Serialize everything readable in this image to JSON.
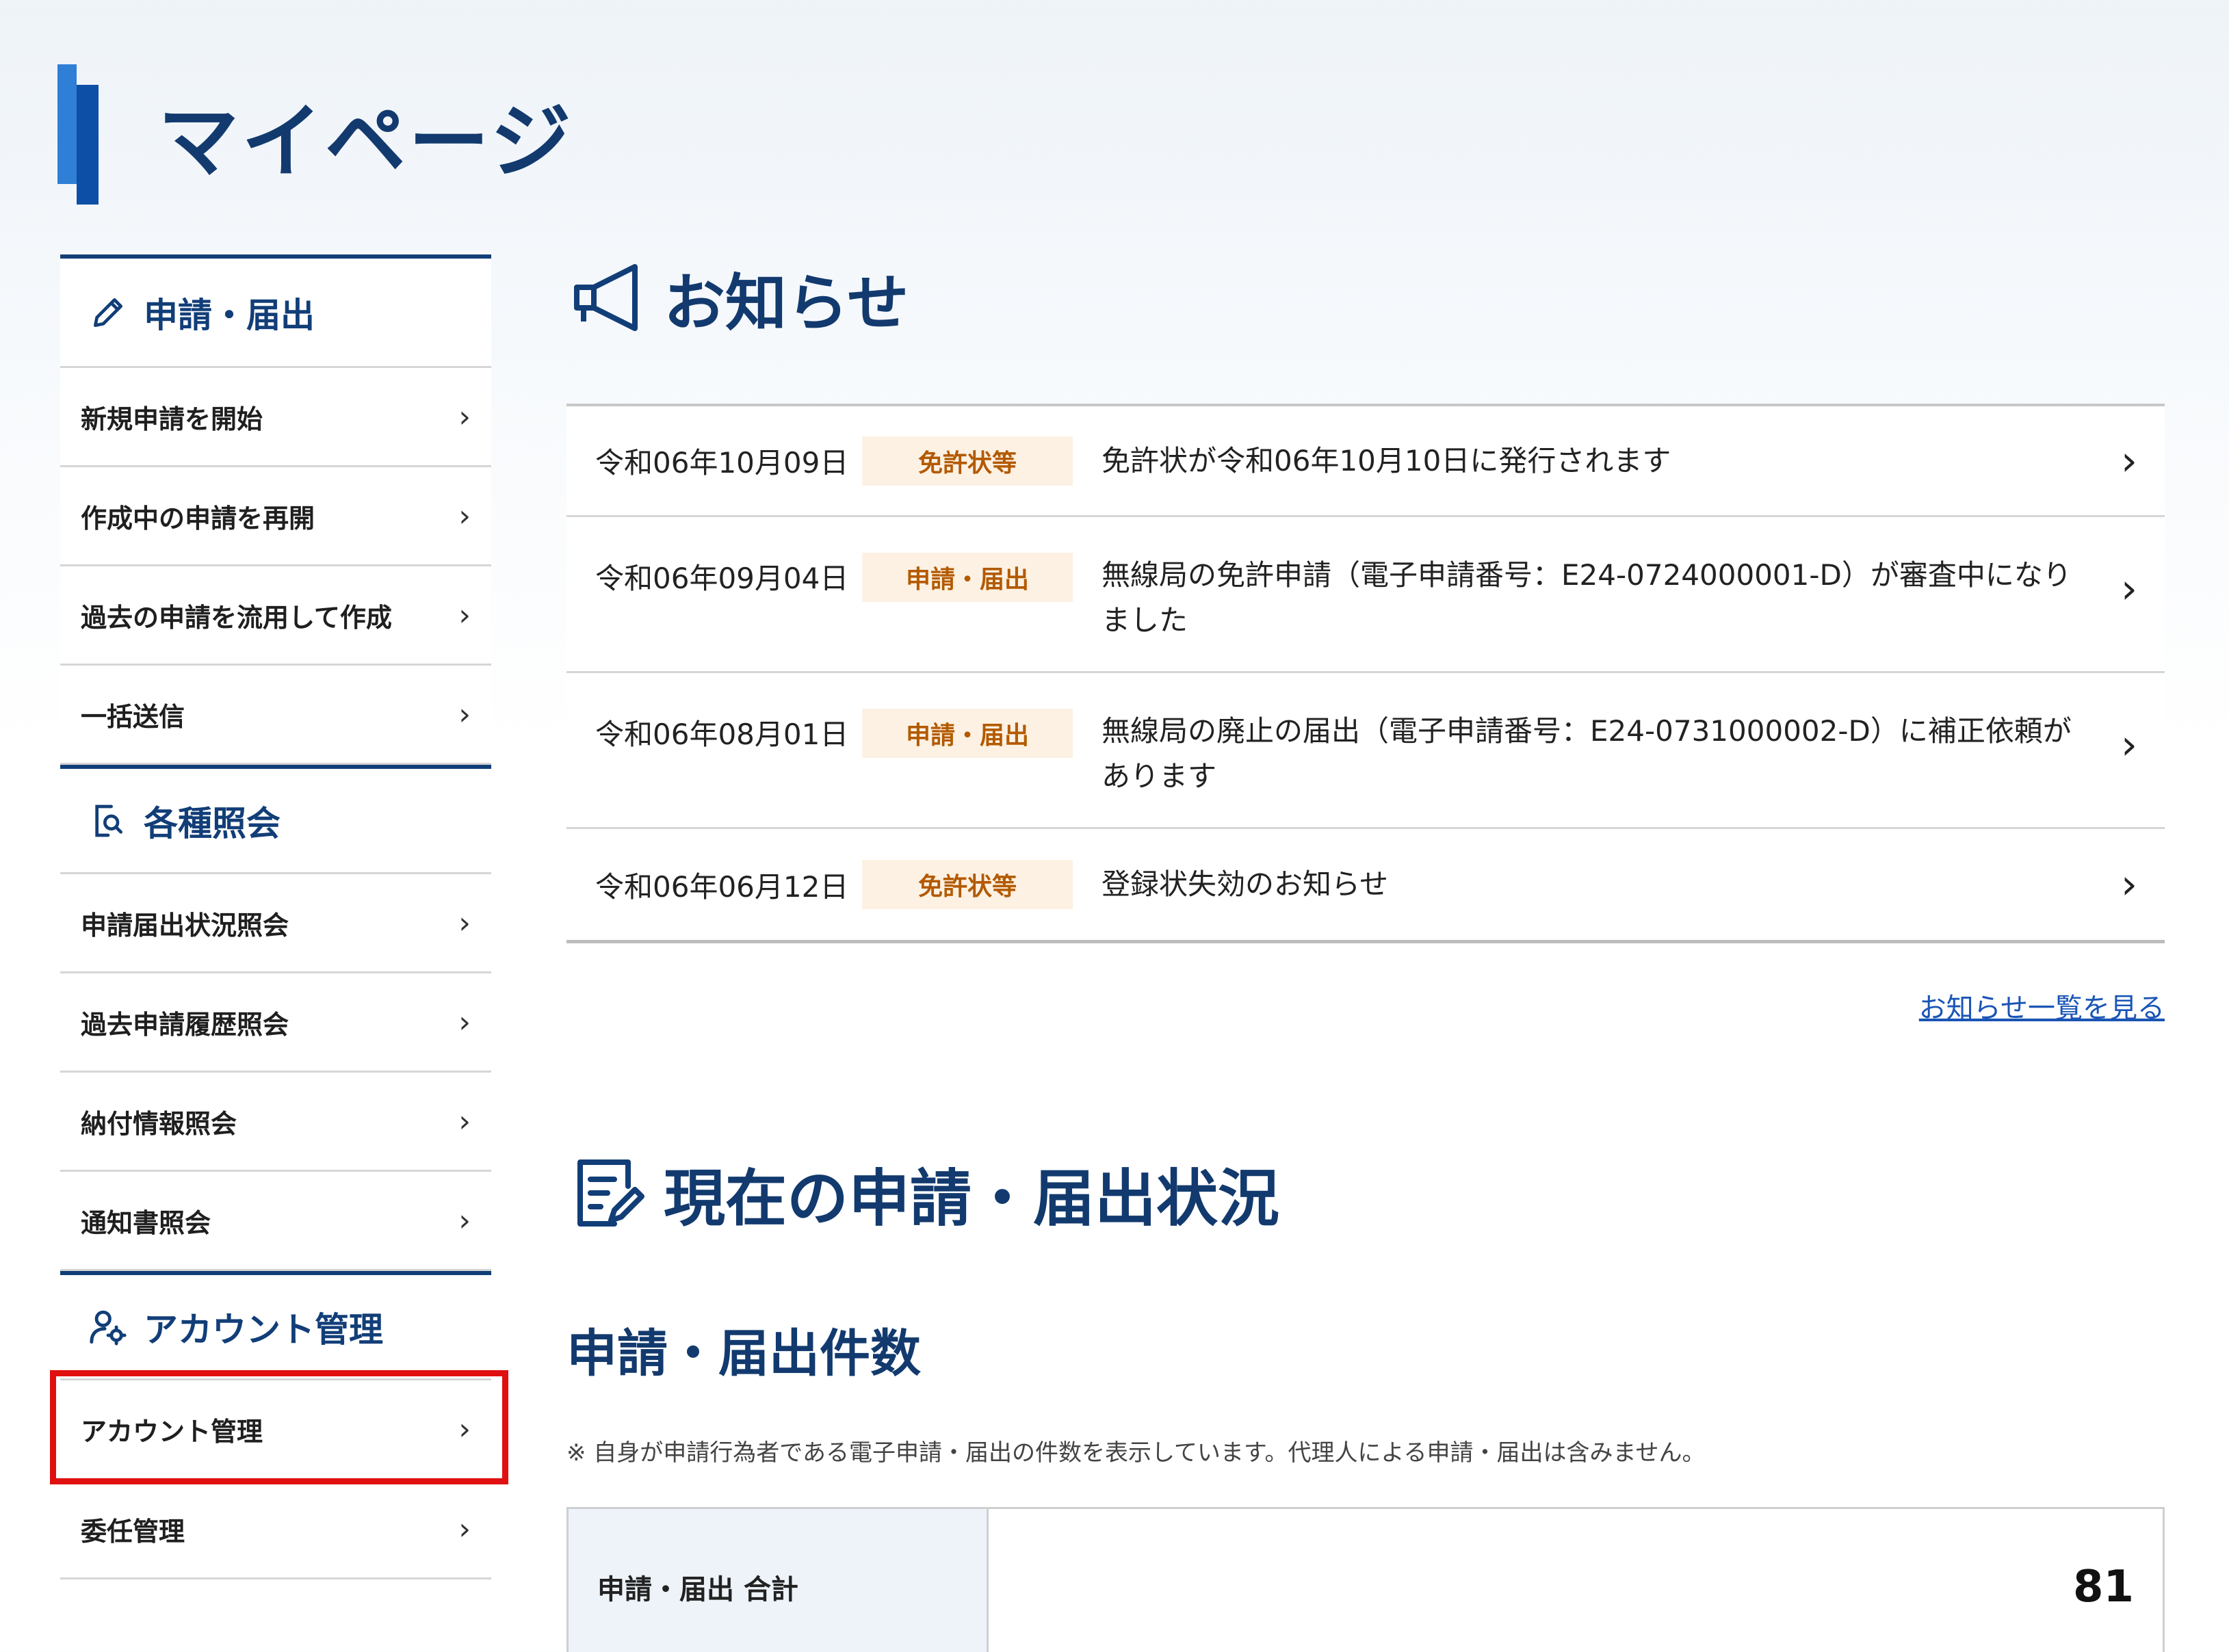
{
  "page": {
    "title": "マイページ"
  },
  "sidebar": {
    "sections": [
      {
        "heading": "申請・届出",
        "icon": "pencil-icon",
        "items": [
          "新規申請を開始",
          "作成中の申請を再開",
          "過去の申請を流用して作成",
          "一括送信"
        ]
      },
      {
        "heading": "各種照会",
        "icon": "document-search-icon",
        "items": [
          "申請届出状況照会",
          "過去申請履歴照会",
          "納付情報照会",
          "通知書照会"
        ]
      },
      {
        "heading": "アカウント管理",
        "icon": "user-gear-icon",
        "items": [
          "アカウント管理",
          "委任管理"
        ]
      }
    ],
    "highlighted_item": "アカウント管理"
  },
  "notices": {
    "heading": "お知らせ",
    "icon": "megaphone-icon",
    "items": [
      {
        "date": "令和06年10月09日",
        "category": "免許状等",
        "text": "免許状が令和06年10月10日に発行されます"
      },
      {
        "date": "令和06年09月04日",
        "category": "申請・届出",
        "text": "無線局の免許申請（電子申請番号：E24-0724000001-D）が審査中になりました"
      },
      {
        "date": "令和06年08月01日",
        "category": "申請・届出",
        "text": "無線局の廃止の届出（電子申請番号：E24-0731000002-D）に補正依頼があります"
      },
      {
        "date": "令和06年06月12日",
        "category": "免許状等",
        "text": "登録状失効のお知らせ"
      }
    ],
    "list_link": "お知らせ一覧を見る"
  },
  "status": {
    "heading": "現在の申請・届出状況",
    "icon": "clipboard-edit-icon",
    "count_heading": "申請・届出件数",
    "note": "※ 自身が申請行為者である電子申請・届出の件数を表示しています。代理人による申請・届出は含みません。",
    "total_label": "申請・届出 合計",
    "total_value": "81"
  },
  "colors": {
    "brand_navy": "#123e78",
    "badge_bg": "#fdf1e3",
    "badge_text": "#b35a00",
    "highlight": "#e01010",
    "link": "#1a55b5"
  }
}
